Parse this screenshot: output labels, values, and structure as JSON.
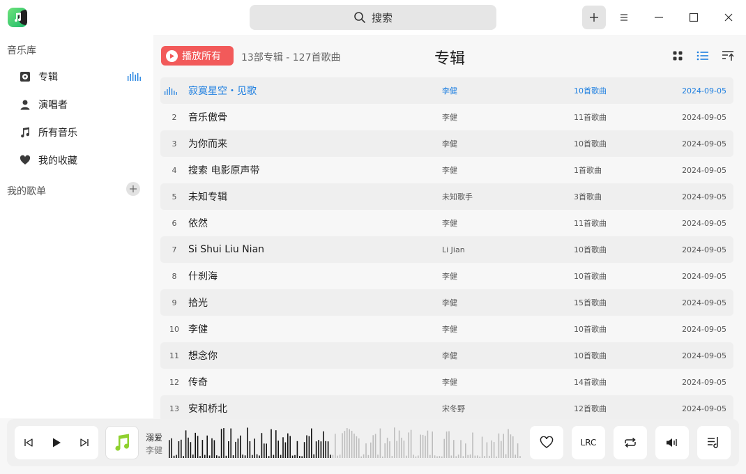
{
  "app": {
    "icon": "music-note-icon",
    "accent_color": "#1e7fe0",
    "play_all_color": "#f25a5a"
  },
  "titlebar": {
    "search_placeholder": "搜索"
  },
  "sidebar": {
    "library_title": "音乐库",
    "items": [
      {
        "label": "专辑",
        "icon": "album-icon"
      },
      {
        "label": "演唱者",
        "icon": "person-icon"
      },
      {
        "label": "所有音乐",
        "icon": "music-note-icon"
      },
      {
        "label": "我的收藏",
        "icon": "heart-icon"
      }
    ],
    "playlists_title": "我的歌单"
  },
  "main": {
    "play_all_label": "播放所有",
    "summary": "13部专辑 - 127首歌曲",
    "title": "专辑",
    "albums": [
      {
        "index": "",
        "name": "寂寞星空・见歌",
        "artist": "李健",
        "count": "10首歌曲",
        "date": "2024-09-05",
        "active": true
      },
      {
        "index": "2",
        "name": "音乐傲骨",
        "artist": "李健",
        "count": "11首歌曲",
        "date": "2024-09-05"
      },
      {
        "index": "3",
        "name": "为你而来",
        "artist": "李健",
        "count": "10首歌曲",
        "date": "2024-09-05"
      },
      {
        "index": "4",
        "name": "搜索 电影原声带",
        "artist": "李健",
        "count": "1首歌曲",
        "date": "2024-09-05"
      },
      {
        "index": "5",
        "name": "未知专辑",
        "artist": "未知歌手",
        "count": "3首歌曲",
        "date": "2024-09-05"
      },
      {
        "index": "6",
        "name": "依然",
        "artist": "李健",
        "count": "11首歌曲",
        "date": "2024-09-05"
      },
      {
        "index": "7",
        "name": "Si Shui Liu Nian",
        "artist": "Li Jian",
        "count": "10首歌曲",
        "date": "2024-09-05"
      },
      {
        "index": "8",
        "name": "什刹海",
        "artist": "李健",
        "count": "10首歌曲",
        "date": "2024-09-05"
      },
      {
        "index": "9",
        "name": "拾光",
        "artist": "李健",
        "count": "15首歌曲",
        "date": "2024-09-05"
      },
      {
        "index": "10",
        "name": "李健",
        "artist": "李健",
        "count": "10首歌曲",
        "date": "2024-09-05"
      },
      {
        "index": "11",
        "name": "想念你",
        "artist": "李健",
        "count": "10首歌曲",
        "date": "2024-09-05"
      },
      {
        "index": "12",
        "name": "传奇",
        "artist": "李健",
        "count": "14首歌曲",
        "date": "2024-09-05"
      },
      {
        "index": "13",
        "name": "安和桥北",
        "artist": "宋冬野",
        "count": "12首歌曲",
        "date": "2024-09-05"
      }
    ]
  },
  "player": {
    "title": "溺爱",
    "artist": "李健",
    "progress": 0.46,
    "lrc_label": "LRC"
  }
}
